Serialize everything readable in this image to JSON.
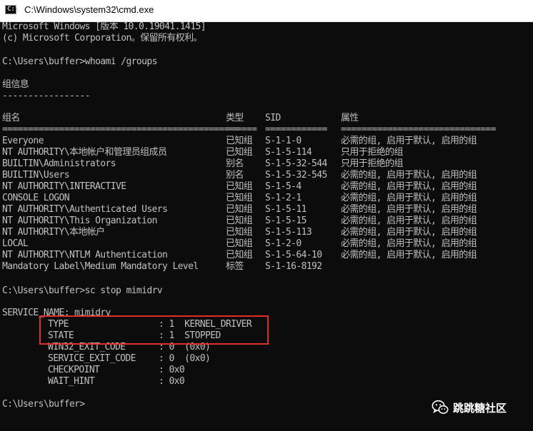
{
  "window": {
    "title": "C:\\Windows\\system32\\cmd.exe"
  },
  "console": {
    "banner": [
      "Microsoft Windows [版本 10.0.19041.1415]",
      "(c) Microsoft Corporation。保留所有权利。"
    ],
    "prompt1": "C:\\Users\\buffer>whoami /groups",
    "group_info_title": "组信息",
    "group_info_rule": "-----------------",
    "table": {
      "headers": [
        "组名",
        "类型",
        "SID",
        "属性"
      ],
      "separators": [
        "==============================================",
        "======",
        "============",
        "=============================="
      ],
      "rows": [
        [
          "Everyone",
          "已知组",
          "S-1-1-0",
          "必需的组, 启用于默认, 启用的组"
        ],
        [
          "NT AUTHORITY\\本地帐户和管理员组成员",
          "已知组",
          "S-1-5-114",
          "只用于拒绝的组"
        ],
        [
          "BUILTIN\\Administrators",
          "别名",
          "S-1-5-32-544",
          "只用于拒绝的组"
        ],
        [
          "BUILTIN\\Users",
          "别名",
          "S-1-5-32-545",
          "必需的组, 启用于默认, 启用的组"
        ],
        [
          "NT AUTHORITY\\INTERACTIVE",
          "已知组",
          "S-1-5-4",
          "必需的组, 启用于默认, 启用的组"
        ],
        [
          "CONSOLE LOGON",
          "已知组",
          "S-1-2-1",
          "必需的组, 启用于默认, 启用的组"
        ],
        [
          "NT AUTHORITY\\Authenticated Users",
          "已知组",
          "S-1-5-11",
          "必需的组, 启用于默认, 启用的组"
        ],
        [
          "NT AUTHORITY\\This Organization",
          "已知组",
          "S-1-5-15",
          "必需的组, 启用于默认, 启用的组"
        ],
        [
          "NT AUTHORITY\\本地帐户",
          "已知组",
          "S-1-5-113",
          "必需的组, 启用于默认, 启用的组"
        ],
        [
          "LOCAL",
          "已知组",
          "S-1-2-0",
          "必需的组, 启用于默认, 启用的组"
        ],
        [
          "NT AUTHORITY\\NTLM Authentication",
          "已知组",
          "S-1-5-64-10",
          "必需的组, 启用于默认, 启用的组"
        ],
        [
          "Mandatory Label\\Medium Mandatory Level",
          "标签",
          "S-1-16-8192",
          ""
        ]
      ]
    },
    "prompt2": "C:\\Users\\buffer>sc stop mimidrv",
    "service_name": "SERVICE_NAME: mimidrv",
    "service_fields": [
      {
        "key": "TYPE",
        "value": ": 1  KERNEL_DRIVER"
      },
      {
        "key": "STATE",
        "value": ": 1  STOPPED"
      },
      {
        "key": "WIN32_EXIT_CODE",
        "value": ": 0  (0x0)"
      },
      {
        "key": "SERVICE_EXIT_CODE",
        "value": ": 0  (0x0)"
      },
      {
        "key": "CHECKPOINT",
        "value": ": 0x0"
      },
      {
        "key": "WAIT_HINT",
        "value": ": 0x0"
      }
    ],
    "prompt3": "C:\\Users\\buffer>"
  },
  "watermark": {
    "icon": "wechat-icon",
    "text": "跳跳糖社区"
  },
  "colors": {
    "console_bg": "#0c0c0c",
    "console_fg": "#c0c0c0",
    "highlight": "#e0302a"
  }
}
